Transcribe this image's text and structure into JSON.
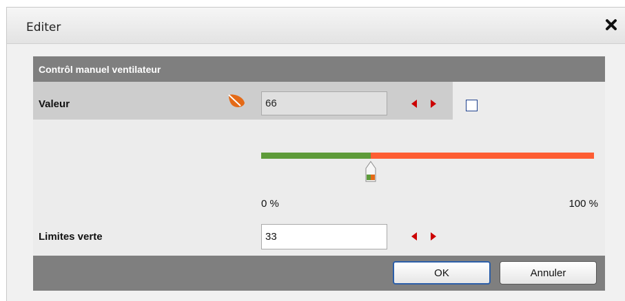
{
  "dialog": {
    "title": "Editer",
    "icons": {
      "close": "close-icon"
    }
  },
  "section": {
    "title": "Contrôl manuel ventilateur"
  },
  "valeur": {
    "label": "Valeur",
    "value": "66",
    "icon": "leaf-icon",
    "checkbox_checked": false
  },
  "slider": {
    "level_percent": 33,
    "min_label": "0 %",
    "max_label": "100 %",
    "colors": {
      "green": "#5e9b3a",
      "red": "#fd5d33"
    }
  },
  "limites": {
    "label": "Limites verte",
    "value": "33"
  },
  "buttons": {
    "ok": "OK",
    "cancel": "Annuler"
  },
  "colors": {
    "header_bg": "#7f7f7f",
    "arrow": "#cc0000",
    "accent": "#e46a17"
  }
}
